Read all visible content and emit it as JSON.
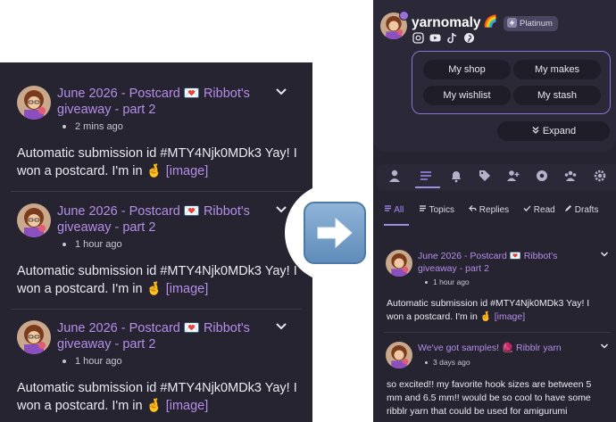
{
  "left_posts": [
    {
      "title": "June 2026 - Postcard 💌 Ribbot's giveaway - part 2",
      "time": "2 mins ago",
      "body": "Automatic submission id #MTY4Njk0MDk3 Yay! I won a postcard. I'm in 🤞",
      "image_link": "[image]"
    },
    {
      "title": "June 2026 - Postcard 💌 Ribbot's giveaway - part 2",
      "time": "1 hour ago",
      "body": "Automatic submission id #MTY4Njk0MDk3 Yay! I won a postcard. I'm in 🤞",
      "image_link": "[image]"
    },
    {
      "title": "June 2026 - Postcard 💌 Ribbot's giveaway - part 2",
      "time": "1 hour ago",
      "body": "Automatic submission id #MTY4Njk0MDk3 Yay! I won a postcard. I'm in 🤞",
      "image_link": "[image]"
    }
  ],
  "profile": {
    "username": "yarnomaly",
    "emoji": "🌈",
    "badge": "Platinum",
    "socials": [
      "instagram-icon",
      "youtube-icon",
      "tiktok-icon",
      "pinterest-icon"
    ]
  },
  "profile_menu": {
    "my_shop": "My shop",
    "my_makes": "My makes",
    "my_wishlist": "My wishlist",
    "my_stash": "My stash",
    "expand": "Expand"
  },
  "icon_tabs": [
    "profile-icon",
    "feed-icon",
    "bell-icon",
    "tag-icon",
    "add-user-icon",
    "gear-badge-icon",
    "group-icon",
    "settings-icon"
  ],
  "filters": {
    "all": "All",
    "topics": "Topics",
    "replies": "Replies",
    "read": "Read",
    "drafts": "Drafts"
  },
  "right_posts": [
    {
      "title": "June 2026 - Postcard 💌 Ribbot's giveaway - part 2",
      "time": "1 hour ago",
      "body": "Automatic submission id #MTY4Njk0MDk3 Yay! I won a postcard. I'm in 🤞",
      "image_link": "[image]"
    },
    {
      "title": "We've got samples! 🧶 Ribblr yarn",
      "time": "3 days ago",
      "body": "so excited!! my favorite hook sizes are between 5 mm and 6.5 mm!! would be so cool to have some ribblr yarn that could be used for amigurumi"
    }
  ],
  "colors": {
    "panel_bg": "#262431",
    "accent_purple": "#b58ee8",
    "filter_active": "#a58bf0"
  }
}
